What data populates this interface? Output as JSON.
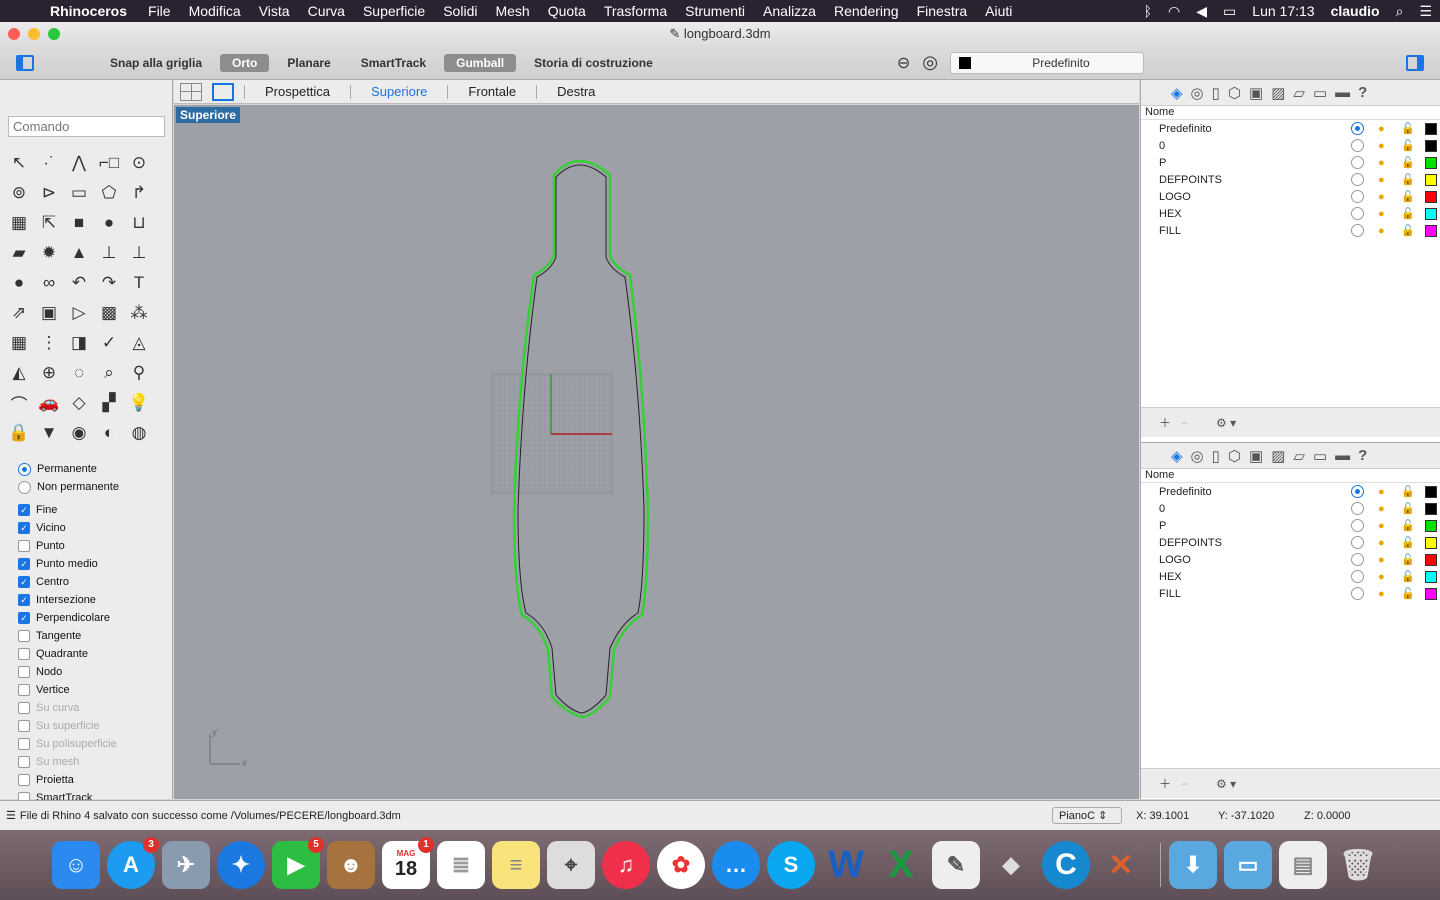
{
  "menubar": {
    "app": "Rhinoceros",
    "items": [
      "File",
      "Modifica",
      "Vista",
      "Curva",
      "Superficie",
      "Solidi",
      "Mesh",
      "Quota",
      "Trasforma",
      "Strumenti",
      "Analizza",
      "Rendering",
      "Finestra",
      "Aiuti"
    ],
    "clock": "Lun 17:13",
    "user": "claudio"
  },
  "window": {
    "title": "longboard.3dm"
  },
  "toolbar": {
    "snap": "Snap alla griglia",
    "orto": "Orto",
    "planare": "Planare",
    "smarttrack": "SmartTrack",
    "gumball": "Gumball",
    "history": "Storia di costruzione",
    "layer": "Predefinito"
  },
  "command": {
    "placeholder": "Comando"
  },
  "viewport_tabs": [
    "Prospettica",
    "Superiore",
    "Frontale",
    "Destra"
  ],
  "viewport": {
    "label": "Superiore",
    "axis_x": "x",
    "axis_y": "y"
  },
  "osnap": {
    "permanente": "Permanente",
    "non_permanente": "Non permanente",
    "items": [
      {
        "label": "Fine",
        "checked": true,
        "enabled": true
      },
      {
        "label": "Vicino",
        "checked": true,
        "enabled": true
      },
      {
        "label": "Punto",
        "checked": false,
        "enabled": true
      },
      {
        "label": "Punto medio",
        "checked": true,
        "enabled": true
      },
      {
        "label": "Centro",
        "checked": true,
        "enabled": true
      },
      {
        "label": "Intersezione",
        "checked": true,
        "enabled": true
      },
      {
        "label": "Perpendicolare",
        "checked": true,
        "enabled": true
      },
      {
        "label": "Tangente",
        "checked": false,
        "enabled": true
      },
      {
        "label": "Quadrante",
        "checked": false,
        "enabled": true
      },
      {
        "label": "Nodo",
        "checked": false,
        "enabled": true
      },
      {
        "label": "Vertice",
        "checked": false,
        "enabled": true
      },
      {
        "label": "Su curva",
        "checked": false,
        "enabled": false
      },
      {
        "label": "Su superficie",
        "checked": false,
        "enabled": false
      },
      {
        "label": "Su polisuperficie",
        "checked": false,
        "enabled": false
      },
      {
        "label": "Su mesh",
        "checked": false,
        "enabled": false
      },
      {
        "label": "Proietta",
        "checked": false,
        "enabled": true
      },
      {
        "label": "SmartTrack",
        "checked": false,
        "enabled": true
      }
    ]
  },
  "layers": {
    "header": "Nome",
    "rows": [
      {
        "name": "Predefinito",
        "color": "#000000",
        "current": true
      },
      {
        "name": "0",
        "color": "#000000",
        "current": false
      },
      {
        "name": "P",
        "color": "#00e000",
        "current": false
      },
      {
        "name": "DEFPOINTS",
        "color": "#ffff00",
        "current": false
      },
      {
        "name": "LOGO",
        "color": "#ff0000",
        "current": false
      },
      {
        "name": "HEX",
        "color": "#00ffff",
        "current": false
      },
      {
        "name": "FILL",
        "color": "#ff00ff",
        "current": false
      }
    ]
  },
  "status": {
    "message": "File di Rhino 4 salvato con successo come /Volumes/PECERE/longboard.3dm",
    "cplane": "PianoC",
    "x": "X: 39.1001",
    "y": "Y: -37.1020",
    "z": "Z: 0.0000"
  },
  "dock": {
    "badges": {
      "appstore": "3",
      "facetime": "5",
      "calendar": "1"
    },
    "calendar_month": "MAG",
    "calendar_day": "18"
  },
  "colors": {
    "accent": "#1b74e4",
    "curve": "#2ecc40",
    "viewport": "#9da1a7"
  }
}
